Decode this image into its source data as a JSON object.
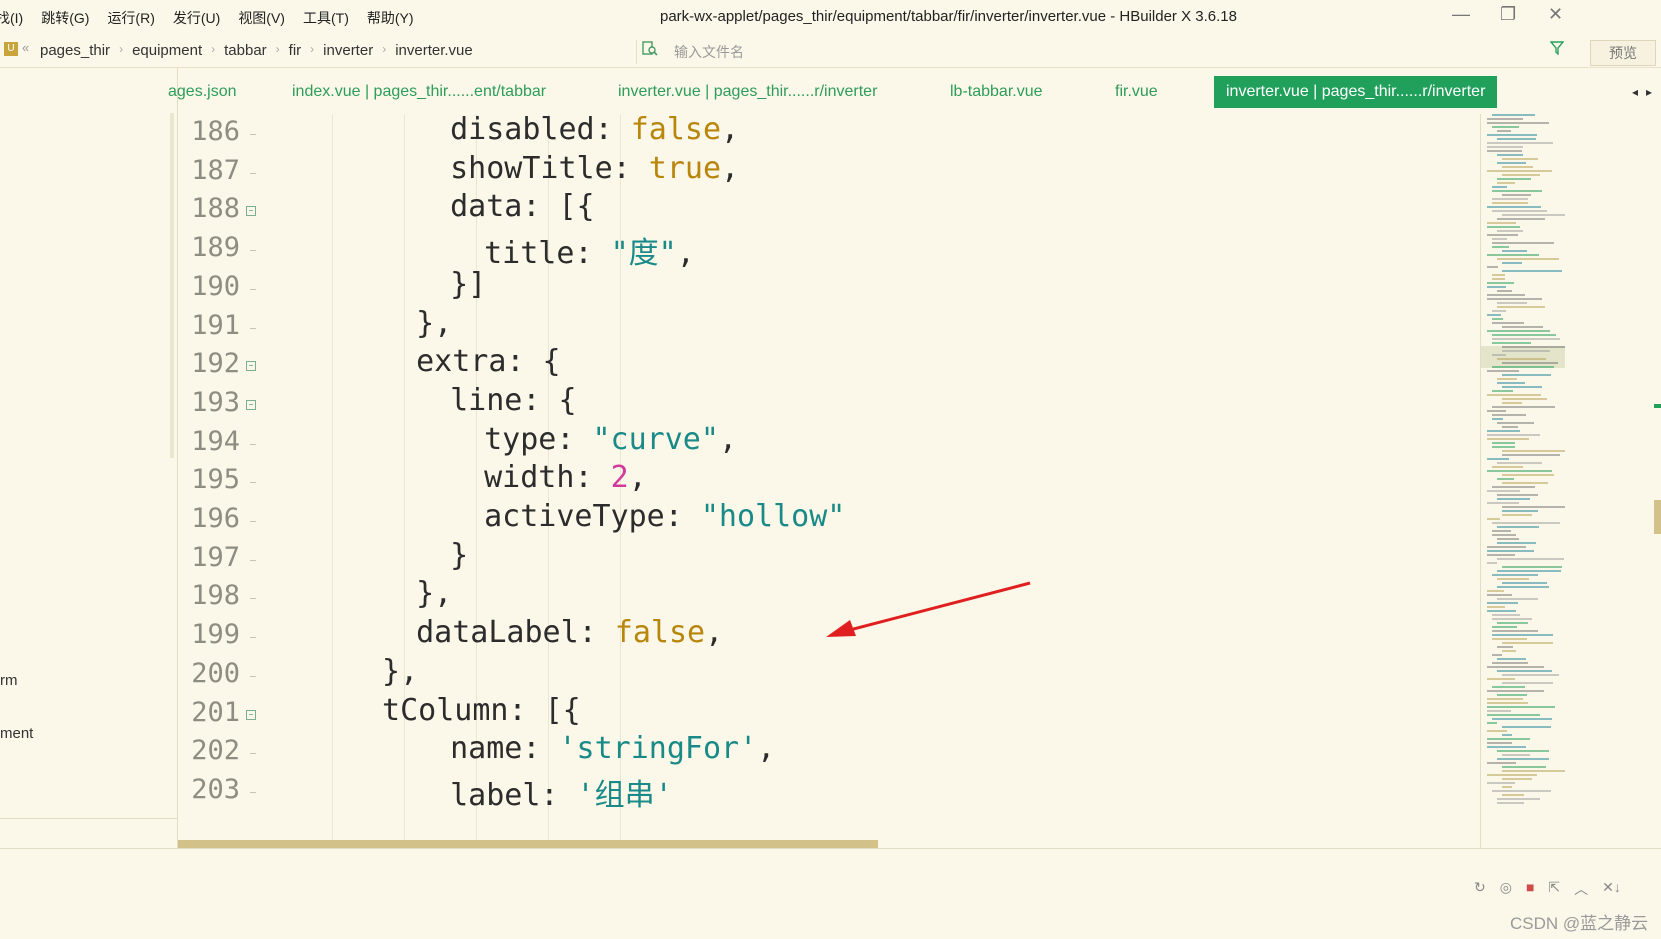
{
  "menu": [
    "找(I)",
    "跳转(G)",
    "运行(R)",
    "发行(U)",
    "视图(V)",
    "工具(T)",
    "帮助(Y)"
  ],
  "window_title": "park-wx-applet/pages_thir/equipment/tabbar/fir/inverter/inverter.vue - HBuilder X 3.6.18",
  "window_controls": [
    "—",
    "❐",
    "✕"
  ],
  "breadcrumb": {
    "project_icon": "U",
    "back": "«",
    "items": [
      "pages_thir",
      "equipment",
      "tabbar",
      "fir",
      "inverter",
      "inverter.vue"
    ],
    "separator": "›"
  },
  "search": {
    "placeholder": "输入文件名",
    "icon": "file-search-icon"
  },
  "filter_icon": "funnel-icon",
  "preview_button": "预览",
  "left_panel": {
    "items": [
      "rm",
      "ment"
    ]
  },
  "tabs": [
    {
      "label": "ages.json"
    },
    {
      "label": "index.vue | pages_thir......ent/tabbar"
    },
    {
      "label": "inverter.vue | pages_thir......r/inverter"
    },
    {
      "label": "lb-tabbar.vue"
    },
    {
      "label": "fir.vue"
    },
    {
      "label": "inverter.vue | pages_thir......r/inverter",
      "active": true
    }
  ],
  "tab_nav": [
    "◂",
    "▸"
  ],
  "editor": {
    "lines": [
      {
        "n": "186",
        "fold": false
      },
      {
        "n": "187",
        "fold": false
      },
      {
        "n": "188",
        "fold": true
      },
      {
        "n": "189",
        "fold": false
      },
      {
        "n": "190",
        "fold": false
      },
      {
        "n": "191",
        "fold": false
      },
      {
        "n": "192",
        "fold": true
      },
      {
        "n": "193",
        "fold": true
      },
      {
        "n": "194",
        "fold": false
      },
      {
        "n": "195",
        "fold": false
      },
      {
        "n": "196",
        "fold": false
      },
      {
        "n": "197",
        "fold": false
      },
      {
        "n": "198",
        "fold": false
      },
      {
        "n": "199",
        "fold": false
      },
      {
        "n": "200",
        "fold": false
      },
      {
        "n": "201",
        "fold": true
      },
      {
        "n": "202",
        "fold": false
      },
      {
        "n": "203",
        "fold": false
      }
    ],
    "code": [
      {
        "indent": "        ",
        "key": "disabled",
        "value": "false",
        "vtype": "kw",
        "tail": ","
      },
      {
        "indent": "        ",
        "key": "showTitle",
        "value": "true",
        "vtype": "kw",
        "tail": ","
      },
      {
        "indent": "        ",
        "key": "data",
        "value": "[{",
        "vtype": "plain",
        "tail": ""
      },
      {
        "indent": "          ",
        "key": "title",
        "value": "\"度\"",
        "vtype": "str",
        "tail": ","
      },
      {
        "indent": "        ",
        "key": "",
        "value": "}]",
        "vtype": "plain",
        "tail": ""
      },
      {
        "indent": "      ",
        "key": "",
        "value": "},",
        "vtype": "plain",
        "tail": ""
      },
      {
        "indent": "      ",
        "key": "extra",
        "value": "{",
        "vtype": "plain",
        "tail": ""
      },
      {
        "indent": "        ",
        "key": "line",
        "value": "{",
        "vtype": "plain",
        "tail": ""
      },
      {
        "indent": "          ",
        "key": "type",
        "value": "\"curve\"",
        "vtype": "str",
        "tail": ","
      },
      {
        "indent": "          ",
        "key": "width",
        "value": "2",
        "vtype": "num",
        "tail": ","
      },
      {
        "indent": "          ",
        "key": "activeType",
        "value": "\"hollow\"",
        "vtype": "str",
        "tail": ""
      },
      {
        "indent": "        ",
        "key": "",
        "value": "}",
        "vtype": "plain",
        "tail": ""
      },
      {
        "indent": "      ",
        "key": "",
        "value": "},",
        "vtype": "plain",
        "tail": ""
      },
      {
        "indent": "      ",
        "key": "dataLabel",
        "value": "false",
        "vtype": "kw",
        "tail": ","
      },
      {
        "indent": "    ",
        "key": "",
        "value": "},",
        "vtype": "plain",
        "tail": ""
      },
      {
        "indent": "    ",
        "key": "tColumn",
        "value": "[{",
        "vtype": "plain",
        "tail": ""
      },
      {
        "indent": "        ",
        "key": "name",
        "value": "'stringFor'",
        "vtype": "str",
        "tail": ","
      },
      {
        "indent": "        ",
        "key": "label",
        "value": "'组串'",
        "vtype": "str",
        "tail": ""
      }
    ]
  },
  "bottom_tools": [
    "↻",
    "◎",
    "■",
    "⇱",
    "︿",
    "✕↓"
  ],
  "watermark": "CSDN @蓝之静云",
  "colors": {
    "accent": "#21a05c",
    "background": "#fbf8e9",
    "keyword": "#b8860b",
    "string": "#1a8a88",
    "number": "#d13a9b",
    "annotation_arrow": "#e02020"
  }
}
